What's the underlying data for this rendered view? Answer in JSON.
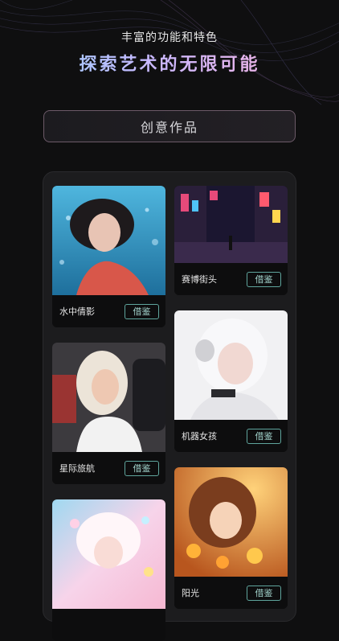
{
  "header": {
    "subtitle": "丰富的功能和特色",
    "headline": "探索艺术的无限可能"
  },
  "tab": {
    "label": "创意作品"
  },
  "works": [
    {
      "title": "水中倩影",
      "button": "借鉴",
      "art_icon": "underwater-girl-image"
    },
    {
      "title": "赛博街头",
      "button": "借鉴",
      "art_icon": "cyber-street-image"
    },
    {
      "title": "星际旅航",
      "button": "借鉴",
      "art_icon": "astronaut-girl-image"
    },
    {
      "title": "机器女孩",
      "button": "借鉴",
      "art_icon": "robot-girl-image"
    },
    {
      "title": "",
      "button": "",
      "art_icon": "fantasy-fairy-image"
    },
    {
      "title": "阳光",
      "button": "借鉴",
      "art_icon": "sunshine-girl-image"
    }
  ],
  "colors": {
    "background": "#0f0f10",
    "panel": "#1c1c1e",
    "button_border": "#5fa59d"
  }
}
